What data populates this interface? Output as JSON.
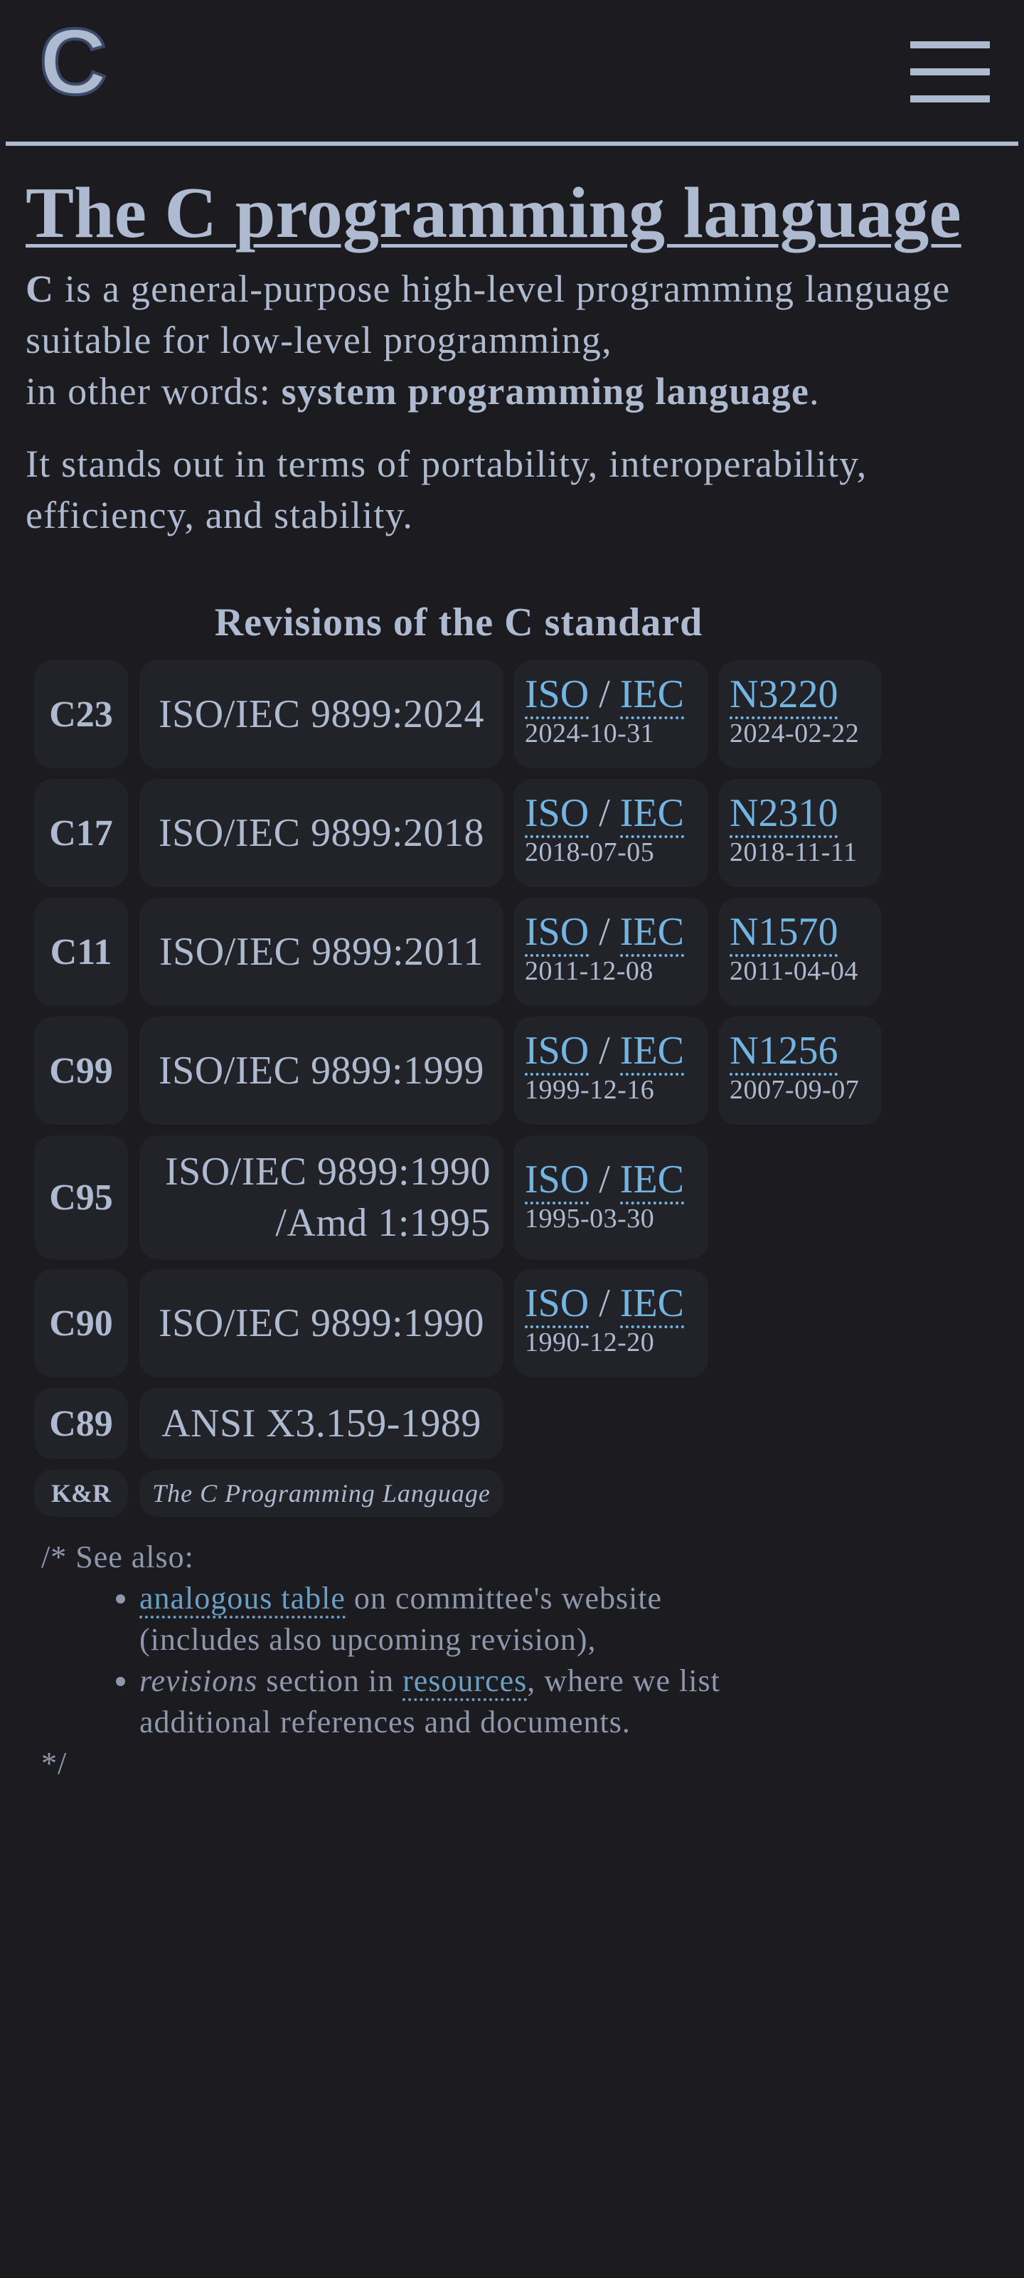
{
  "header": {
    "logo_letter": "C",
    "menu_icon": "hamburger-menu-icon"
  },
  "intro": {
    "title": "The C programming language",
    "p1": {
      "bold_c": "C",
      "text_a": " is a general-purpose high-level programming language suitable for low-level programming,",
      "text_b": "in other words: ",
      "bold_phrase": "system programming language",
      "end": "."
    },
    "p2": "It stands out in terms of portability, interoperability, efficiency, and stability."
  },
  "revisions": {
    "caption": "Revisions of the C standard",
    "separator": "/",
    "rows": [
      {
        "code": "C23",
        "name_lines": [
          "ISO/IEC 9899:2024"
        ],
        "iso": "ISO",
        "iec": "IEC",
        "iso_date": "2024-10-31",
        "draft": "N3220",
        "draft_date": "2024-02-22"
      },
      {
        "code": "C17",
        "name_lines": [
          "ISO/IEC 9899:2018"
        ],
        "iso": "ISO",
        "iec": "IEC",
        "iso_date": "2018-07-05",
        "draft": "N2310",
        "draft_date": "2018-11-11"
      },
      {
        "code": "C11",
        "name_lines": [
          "ISO/IEC 9899:2011"
        ],
        "iso": "ISO",
        "iec": "IEC",
        "iso_date": "2011-12-08",
        "draft": "N1570",
        "draft_date": "2011-04-04"
      },
      {
        "code": "C99",
        "name_lines": [
          "ISO/IEC 9899:1999"
        ],
        "iso": "ISO",
        "iec": "IEC",
        "iso_date": "1999-12-16",
        "draft": "N1256",
        "draft_date": "2007-09-07"
      },
      {
        "code": "C95",
        "name_lines": [
          "ISO/IEC 9899:1990",
          "/Amd 1:1995"
        ],
        "iso": "ISO",
        "iec": "IEC",
        "iso_date": "1995-03-30"
      },
      {
        "code": "C90",
        "name_lines": [
          "ISO/IEC 9899:1990"
        ],
        "iso": "ISO",
        "iec": "IEC",
        "iso_date": "1990-12-20"
      },
      {
        "code": "C89",
        "name_lines": [
          "ANSI X3.159-1989"
        ]
      },
      {
        "code": "K&R",
        "name_lines": [
          "The C Programming Language"
        ]
      }
    ]
  },
  "see_also": {
    "open": "/* See also:",
    "item1": {
      "link": "analogous table",
      "text": " on committee's website (includes also upcoming revision),"
    },
    "item2": {
      "italic": "revisions",
      "text_a": " section in ",
      "link": "resources",
      "text_b": ", where we list additional references and documents."
    },
    "close": "*/"
  }
}
